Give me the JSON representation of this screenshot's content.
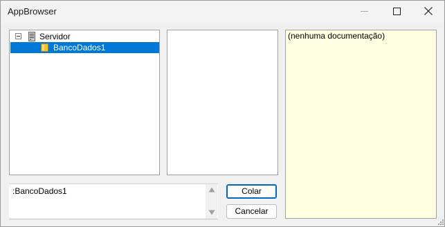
{
  "window": {
    "title": "AppBrowser"
  },
  "tree": {
    "items": [
      {
        "label": "Servidor",
        "expanded": true,
        "icon": "server-icon"
      },
      {
        "label": "BancoDados1",
        "selected": true,
        "icon": "database-icon"
      }
    ]
  },
  "documentation": {
    "text": "(nenhuma documentação)"
  },
  "expression": {
    "value": ":BancoDados1"
  },
  "buttons": {
    "paste_label": "Colar",
    "cancel_label": "Cancelar"
  },
  "colors": {
    "selection": "#0078d7",
    "doc_background": "#ffffe1",
    "default_button_border": "#0067c0",
    "window_background": "#f0f0f0"
  }
}
